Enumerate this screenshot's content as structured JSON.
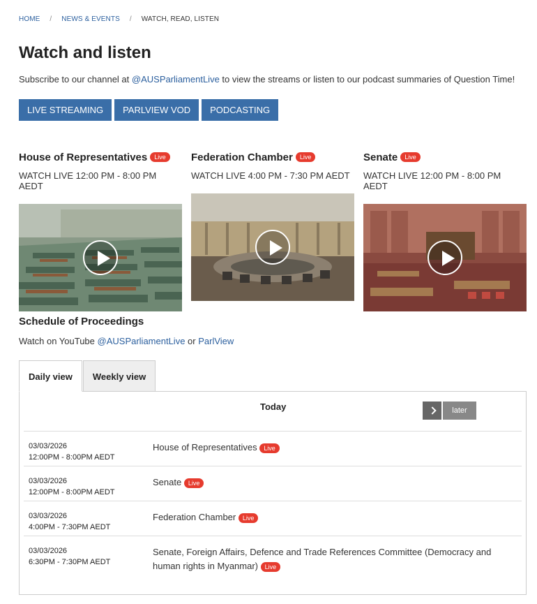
{
  "breadcrumb": {
    "home": "HOME",
    "news": "NEWS & EVENTS",
    "current": "WATCH, READ, LISTEN",
    "sep": "/"
  },
  "title": "Watch and listen",
  "intro": {
    "before": "Subscribe to our channel at ",
    "link": "@AUSParliamentLive",
    "after": " to view the streams or listen to our podcast summaries of Question Time!"
  },
  "buttons": {
    "live": "LIVE STREAMING",
    "vod": "PARLVIEW VOD",
    "podcast": "PODCASTING"
  },
  "live_label": "Live",
  "chambers": [
    {
      "name": "House of Representatives",
      "time": "WATCH LIVE 12:00 PM - 8:00 PM AEDT"
    },
    {
      "name": "Federation Chamber",
      "time": "WATCH LIVE 4:00 PM - 7:30 PM AEDT"
    },
    {
      "name": "Senate",
      "time": "WATCH LIVE 12:00 PM - 8:00 PM AEDT"
    }
  ],
  "schedule": {
    "heading": "Schedule of Proceedings",
    "sub_before": "Watch on YouTube ",
    "sub_link1": "@AUSParliamentLive",
    "sub_mid": " or ",
    "sub_link2": "ParlView",
    "tabs": {
      "daily": "Daily view",
      "weekly": "Weekly view"
    },
    "today": "Today",
    "later": "later",
    "rows": [
      {
        "date": "03/03/2026",
        "time": "12:00PM - 8:00PM AEDT",
        "title": "House of Representatives"
      },
      {
        "date": "03/03/2026",
        "time": "12:00PM - 8:00PM AEDT",
        "title": "Senate"
      },
      {
        "date": "03/03/2026",
        "time": "4:00PM - 7:30PM AEDT",
        "title": "Federation Chamber"
      },
      {
        "date": "03/03/2026",
        "time": "6:30PM - 7:30PM AEDT",
        "title": "Senate, Foreign Affairs, Defence and Trade References Committee (Democracy and human rights in Myanmar)"
      }
    ]
  },
  "colors": {
    "accent": "#3a6ea8",
    "live": "#e63b2e",
    "link": "#2b5f9e"
  }
}
